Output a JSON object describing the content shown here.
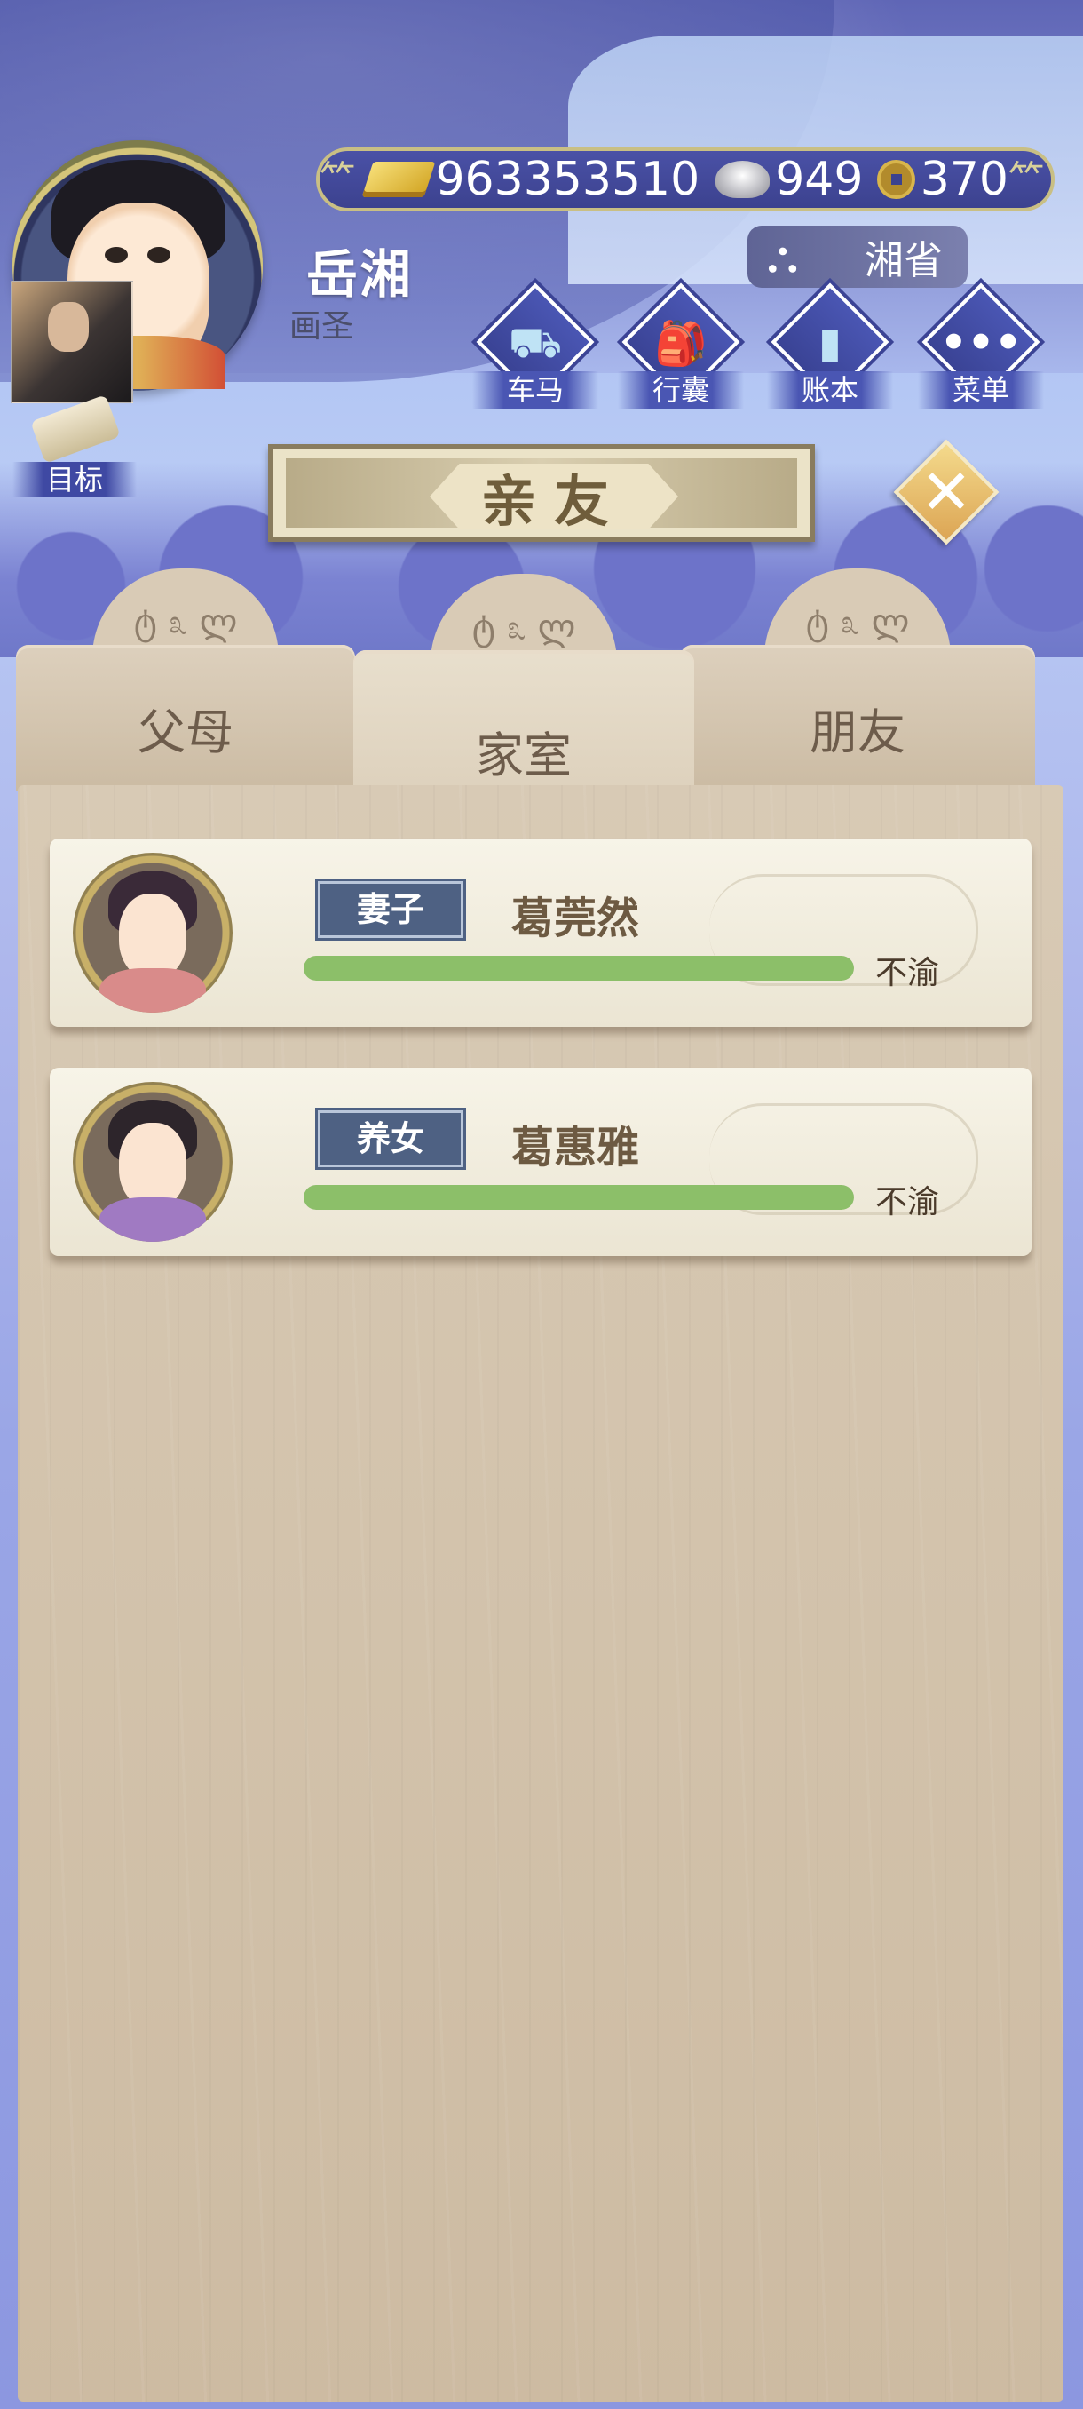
{
  "player": {
    "name": "岳湘",
    "title": "画圣"
  },
  "currency": {
    "gold": "963353510",
    "silver": "949",
    "copper": "370",
    "icons": [
      "gold-ingot-icon",
      "silver-ingot-icon",
      "copper-coin-icon"
    ]
  },
  "location": {
    "label": "湘省",
    "icon": "carriage-icon"
  },
  "menu": [
    {
      "label": "车马",
      "icon": "carriage-icon"
    },
    {
      "label": "行囊",
      "icon": "bag-icon"
    },
    {
      "label": "账本",
      "icon": "ledger-icon"
    },
    {
      "label": "菜单",
      "icon": "more-icon"
    }
  ],
  "goal": {
    "label": "目标"
  },
  "panel_title": "亲友",
  "tabs": [
    {
      "label": "父母",
      "active": false
    },
    {
      "label": "家室",
      "active": true
    },
    {
      "label": "朋友",
      "active": false
    }
  ],
  "relatives": [
    {
      "role": "妻子",
      "name": "葛莞然",
      "mood": "不渝",
      "affinity": 1.0
    },
    {
      "role": "养女",
      "name": "葛惠雅",
      "mood": "不渝",
      "affinity": 1.0
    }
  ],
  "colors": {
    "bar_fill": "#8cbf69",
    "role_badge": "#4e6183",
    "currency_bar": "#3c428f"
  }
}
